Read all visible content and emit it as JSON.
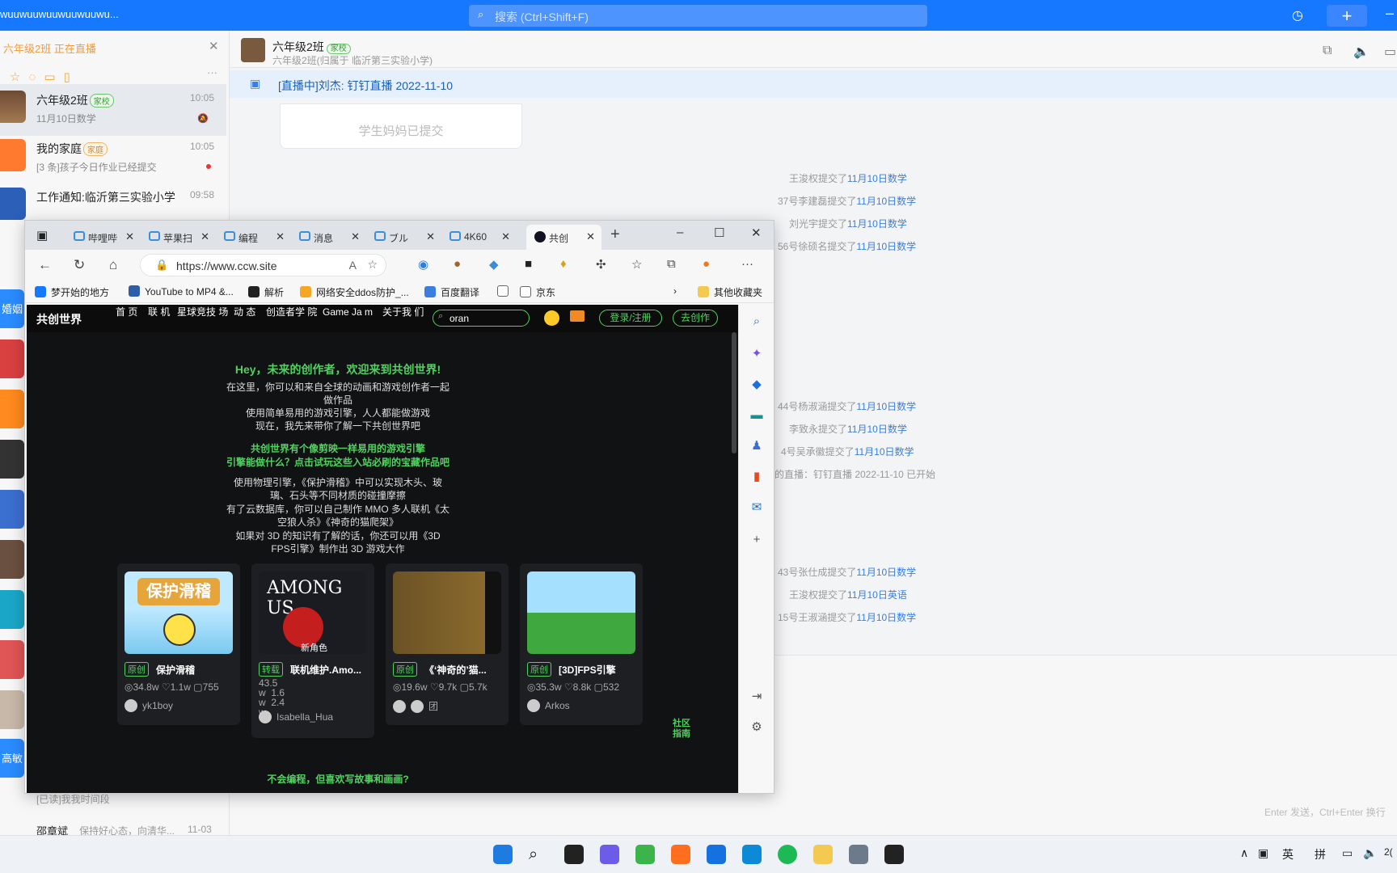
{
  "topbar": {
    "title": "wuuwuuwuuwuuwuuwu...",
    "search_placeholder": "搜索 (Ctrl+Shift+F)"
  },
  "left": {
    "live_header": "六年级2班 正在直播",
    "chats": [
      {
        "name": "六年级2班",
        "tag": "家校",
        "time": "10:05",
        "sub": "11月10日数学"
      },
      {
        "name": "我的家庭",
        "tag": "家庭",
        "time": "10:05",
        "sub": "[3 条]孩子今日作业已经提交"
      },
      {
        "name": "工作通知:临沂第三实验小学",
        "tag": "",
        "time": "09:58",
        "sub": ""
      }
    ],
    "strip_labels": {
      "a": "婚姻",
      "b": "高敏"
    },
    "bottom_chats": [
      {
        "sub": "[已读]我我时间段"
      },
      {
        "name": "邵章斌",
        "sub": "保持好心态，向清华...",
        "time": "11-03"
      }
    ]
  },
  "main": {
    "group_name": "六年级2班",
    "group_tag": "家校",
    "group_sub": "六年级2班(归属于 临沂第三实验小学)",
    "notice": "[直播中]刘杰: 钉钉直播 2022-11-10",
    "card_text": "学生妈妈已提交",
    "sys_msgs": [
      {
        "pre": "王浚权提交了",
        "link": "11月10日数学"
      },
      {
        "pre": "37号李建磊提交了",
        "link": "11月10日数学"
      },
      {
        "pre": "刘光宇提交了",
        "link": "11月10日数学"
      },
      {
        "pre": "56号徐硕名提交了",
        "link": "11月10日数学"
      },
      {
        "pre": "44号杨淑涵提交了",
        "link": "11月10日数学"
      },
      {
        "pre": "李致永提交了",
        "link": "11月10日数学"
      },
      {
        "pre": "4号吴承徽提交了",
        "link": "11月10日数学"
      },
      {
        "pre": "的直播：钉钉直播 2022-11-10 已开始",
        "link": ""
      },
      {
        "pre": "43号张仕成提交了",
        "link": "11月10日数学"
      },
      {
        "pre": "王浚权提交了",
        "link": "11月10日英语"
      },
      {
        "pre": "15号王淑涵提交了",
        "link": "11月10日数学"
      }
    ],
    "input_hint": "Enter 发送，Ctrl+Enter 换行"
  },
  "browser": {
    "tabs": [
      "哔哩哔",
      "苹果扫",
      "编程",
      "消息",
      "ブル",
      "4K60",
      "共创"
    ],
    "url": "https://www.ccw.site",
    "bookmarks": [
      "梦开始的地方",
      "YouTube to MP4 &...",
      "解析",
      "网络安全ddos防护_...",
      "百度翻译",
      "",
      "京东",
      "其他收藏夹"
    ]
  },
  "site": {
    "logo": "共创世界",
    "nav": [
      "首\n页",
      "联\n机",
      "星球竞技\n场",
      "动\n态",
      "创造者学\n院",
      "Game Ja\nm",
      "关于我\n们"
    ],
    "search_value": "oran",
    "login": "登录/注册",
    "create": "去创作",
    "hello": "Hey，未来的创作者，欢迎来到共创世界!",
    "intro": [
      "在这里，你可以和来自全球的动画和游戏创作者一起做作品",
      "使用简单易用的游戏引擎，人人都能做游戏",
      "现在，我先来带你了解一下共创世界吧"
    ],
    "green_lines": [
      "共创世界有个像剪映一样易用的游戏引擎",
      "引擎能做什么？点击试玩这些入站必刷的宝藏作品吧"
    ],
    "para2": [
      "使用物理引擎，《保护滑稽》中可以实现木头、玻璃、石头等不同材质的碰撞摩擦",
      "有了云数据库，你可以自己制作 MMO 多人联机《太空狼人杀》《神奇的猫爬架》",
      "如果对 3D 的知识有了解的话，你还可以用《3D FPS引擎》制作出 3D 游戏大作"
    ],
    "games": [
      {
        "type": "原创",
        "title": "保护滑稽",
        "views": "34.8w",
        "likes": "1.1w",
        "comments": "755",
        "author": "yk1boy",
        "thumb_text": "保护滑稽"
      },
      {
        "type": "转载",
        "title": "联机维护.Amo...",
        "views": "43.5\nw",
        "likes": "1.6\nw",
        "comments": "2.4\nw",
        "author": "Isabella_Hua",
        "thumb_text": "AMONG US",
        "thumb_sub": "新角色"
      },
      {
        "type": "原创",
        "title": "《‘神奇的’猫...",
        "views": "19.6w",
        "likes": "9.7k",
        "comments": "5.7k",
        "author": "团",
        "thumb_text": ""
      },
      {
        "type": "原创",
        "title": "[3D]FPS引擎",
        "views": "35.3w",
        "likes": "8.8k",
        "comments": "532",
        "author": "Arkos",
        "thumb_text": ""
      }
    ],
    "guide": "社区\n指南",
    "footer": "不会编程，但喜欢写故事和画画?"
  },
  "taskbar": {
    "tray": [
      "英",
      "拼"
    ],
    "time_partial": "2("
  }
}
